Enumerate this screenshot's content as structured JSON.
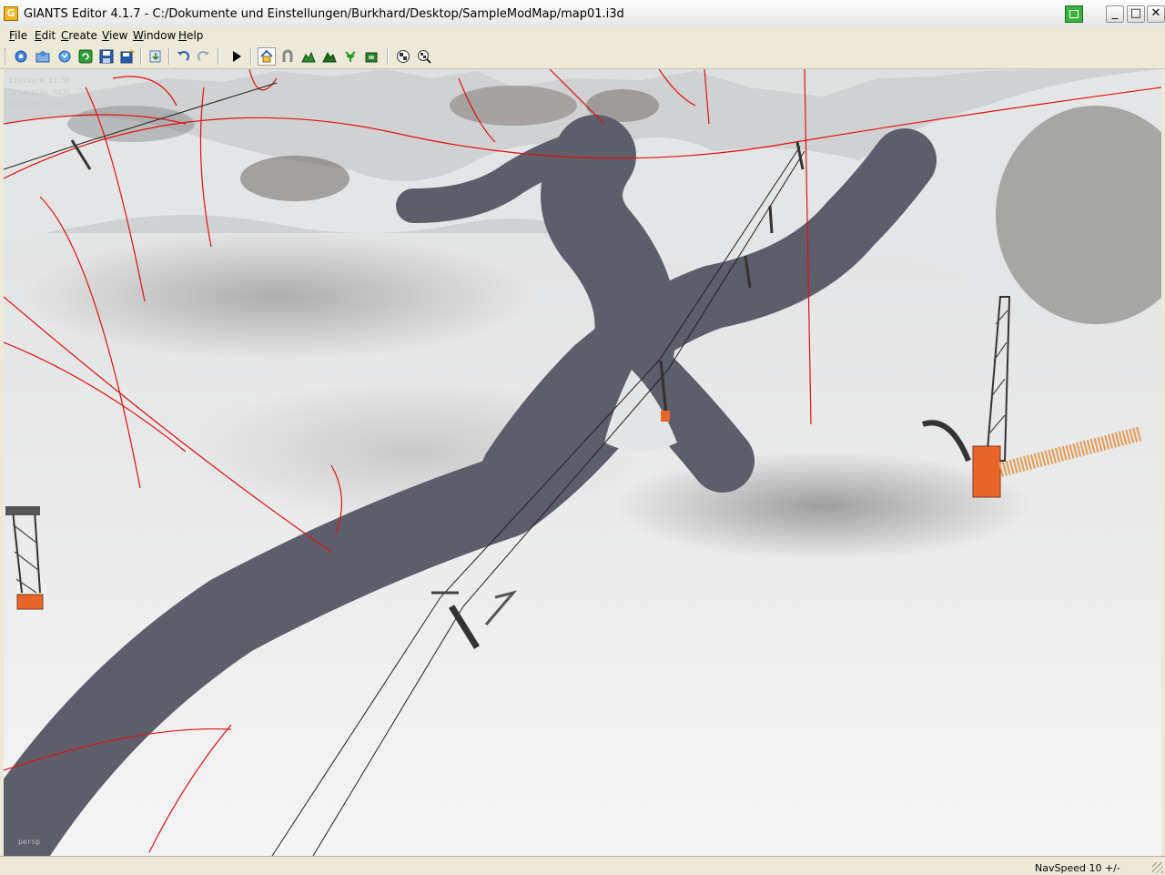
{
  "window": {
    "title": "GIANTS Editor 4.1.7 - C:/Dokumente und Einstellungen/Burkhard/Desktop/SampleModMap/map01.i3d",
    "app_icon": "giants-logo-icon",
    "buttons": {
      "minimize": "_",
      "maximize": "□",
      "close": "✕"
    }
  },
  "menu": [
    "File",
    "Edit",
    "Create",
    "View",
    "Window",
    "Help"
  ],
  "toolbar": {
    "icons": [
      "new-scene-icon",
      "open-file-icon",
      "reload-icon",
      "save-icon",
      "save-as-icon",
      "import-icon",
      "undo-icon",
      "redo-icon",
      "play-icon",
      "home-icon",
      "magnet-icon",
      "terrain-paint-icon",
      "terrain-sculpt-icon",
      "foliage-icon",
      "terrain-info-icon",
      "checker-icon",
      "checker-lens-icon"
    ]
  },
  "viewport": {
    "stats": [
      "Distance 83.56",
      "Triangles 6432",
      "Vertices 2164"
    ],
    "camera_label": "persp",
    "colors": {
      "snow": "#ececec",
      "path": "#5d5e69",
      "spline": "#e01010",
      "lift_cabin": "#e8662c"
    }
  },
  "statusbar": {
    "nav_speed": "NavSpeed 10 +/-"
  }
}
